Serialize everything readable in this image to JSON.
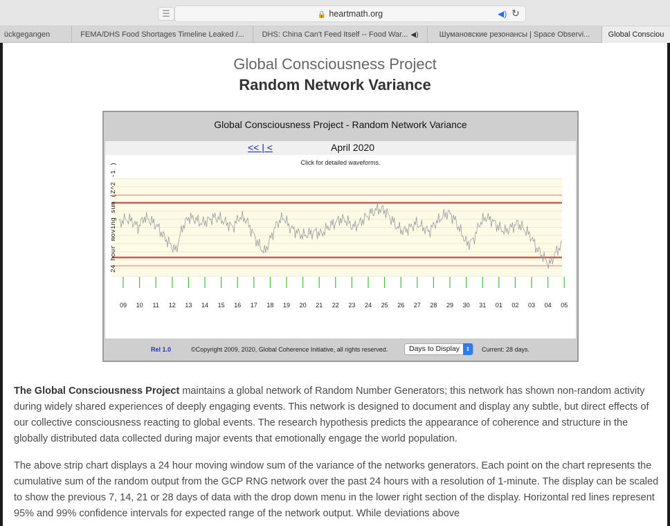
{
  "browser": {
    "url": "heartmath.org",
    "tabs": [
      {
        "label": "ückgegangen",
        "active": false
      },
      {
        "label": "FEMA/DHS Food Shortages Timeline Leaked /...",
        "active": false
      },
      {
        "label": "DHS: China Can't Feed Itself -- Food War...",
        "active": false,
        "audio": true
      },
      {
        "label": "Шумановские резонансы | Space Observi...",
        "active": false
      },
      {
        "label": "Global Consciou",
        "active": true
      }
    ]
  },
  "page": {
    "title": "Global Consciousness Project",
    "subtitle": "Random Network Variance"
  },
  "widget": {
    "title": "Global Consciousness Project - Random Network Variance",
    "nav_links": "<< | <",
    "month": "April 2020",
    "click_note": "Click for detailed waveforms.",
    "rel": "Rel 1.0",
    "copyright": "©Copyright 2009, 2020, Global Coherence Initiative, all rights reserved.",
    "days_select": "Days to Display",
    "current": "Current: 28 days."
  },
  "chart_data": {
    "type": "line",
    "ylabel": "24 hour moving sum (Z^2 -1 )",
    "x_ticks": [
      "09",
      "10",
      "11",
      "12",
      "13",
      "14",
      "15",
      "16",
      "17",
      "18",
      "19",
      "20",
      "21",
      "22",
      "23",
      "24",
      "25",
      "26",
      "27",
      "28",
      "29",
      "30",
      "31",
      "01",
      "02",
      "03",
      "04",
      "05"
    ],
    "series": [
      {
        "values": [
          0.55,
          0.6,
          0.58,
          0.5,
          0.62,
          0.58,
          0.52,
          0.4,
          0.3,
          0.22,
          0.5,
          0.62,
          0.6,
          0.55,
          0.58,
          0.62,
          0.6,
          0.55,
          0.5,
          0.62,
          0.6,
          0.45,
          0.3,
          0.2,
          0.38,
          0.55,
          0.62,
          0.5,
          0.45,
          0.4,
          0.42,
          0.45,
          0.42,
          0.5,
          0.55,
          0.6,
          0.58,
          0.5,
          0.55,
          0.62,
          0.68,
          0.72,
          0.7,
          0.6,
          0.5,
          0.45,
          0.5,
          0.55,
          0.5,
          0.45,
          0.55,
          0.62,
          0.68,
          0.6,
          0.45,
          0.3,
          0.35,
          0.55,
          0.62,
          0.58,
          0.5,
          0.45,
          0.5,
          0.55,
          0.48,
          0.4,
          0.25,
          0.15,
          0.05,
          0.2,
          0.3
        ]
      }
    ],
    "reference_lines_color": "#c0392b",
    "grid": true
  }
}
